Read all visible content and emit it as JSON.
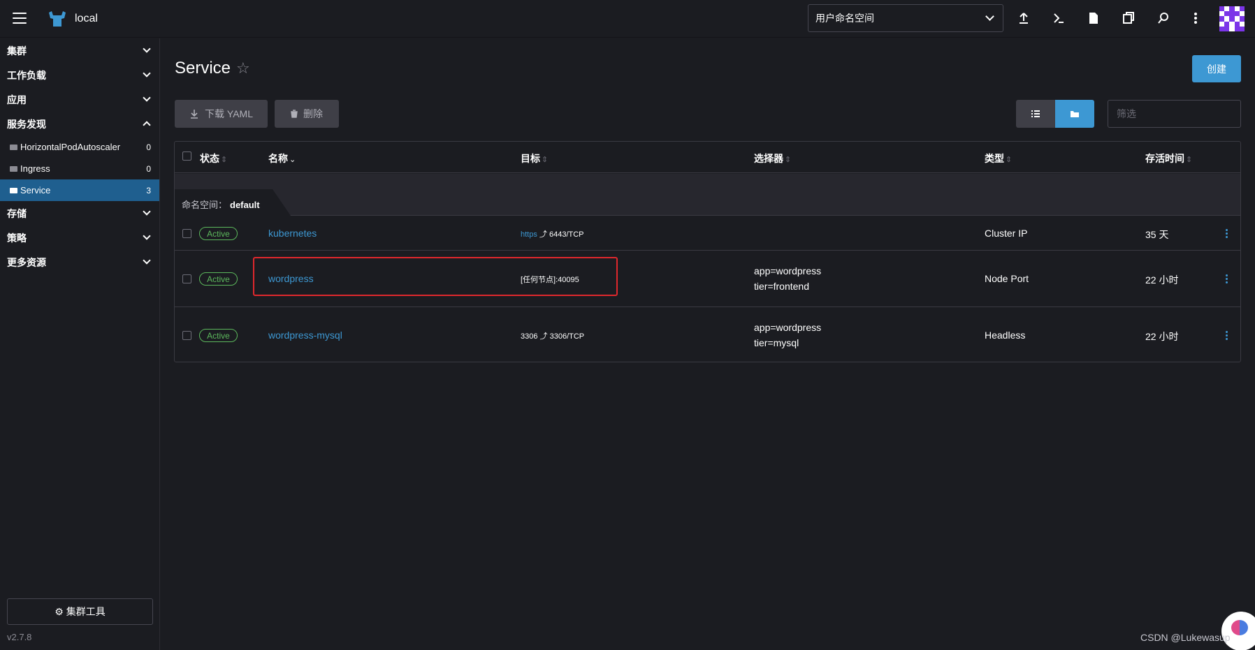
{
  "header": {
    "cluster_name": "local",
    "namespace_select": "用户命名空间",
    "icons": [
      "upload-icon",
      "terminal-icon",
      "file-icon",
      "copy-icon",
      "search-icon",
      "more-vertical-icon"
    ]
  },
  "sidebar": {
    "groups": [
      {
        "label": "集群",
        "expanded": false
      },
      {
        "label": "工作负载",
        "expanded": false
      },
      {
        "label": "应用",
        "expanded": false
      },
      {
        "label": "服务发现",
        "expanded": true
      }
    ],
    "items": [
      {
        "label": "HorizontalPodAutoscaler",
        "count": "0"
      },
      {
        "label": "Ingress",
        "count": "0"
      },
      {
        "label": "Service",
        "count": "3",
        "active": true
      }
    ],
    "groups_after": [
      {
        "label": "存储"
      },
      {
        "label": "策略"
      },
      {
        "label": "更多资源"
      }
    ],
    "cluster_tools": "集群工具",
    "version": "v2.7.8"
  },
  "main": {
    "title": "Service",
    "create_label": "创建",
    "download_yaml": "下载 YAML",
    "delete_label": "删除",
    "filter_placeholder": "筛选"
  },
  "table": {
    "headers": [
      "状态",
      "名称",
      "目标",
      "选择器",
      "类型",
      "存活时间"
    ],
    "namespace_label": "命名空间：",
    "namespace_value": "default",
    "rows": [
      {
        "status": "Active",
        "name": "kubernetes",
        "target_prefix": "https",
        "target_port": "6443/TCP",
        "selector": [],
        "type": "Cluster IP",
        "age": "35 天"
      },
      {
        "status": "Active",
        "name": "wordpress",
        "target_prefix": "",
        "target_port": "[任何节点]:40095",
        "selector": [
          "app=wordpress",
          "tier=frontend"
        ],
        "type": "Node Port",
        "age": "22 小时"
      },
      {
        "status": "Active",
        "name": "wordpress-mysql",
        "target_prefix": "3306",
        "target_port": "3306/TCP",
        "selector": [
          "app=wordpress",
          "tier=mysql"
        ],
        "type": "Headless",
        "age": "22 小时"
      }
    ]
  },
  "watermark": "CSDN @Lukewasup",
  "colors": {
    "background": "#1b1c21",
    "accent": "#3d98d3",
    "active_badge": "#5cb85c",
    "highlight_box": "#e0282d"
  }
}
